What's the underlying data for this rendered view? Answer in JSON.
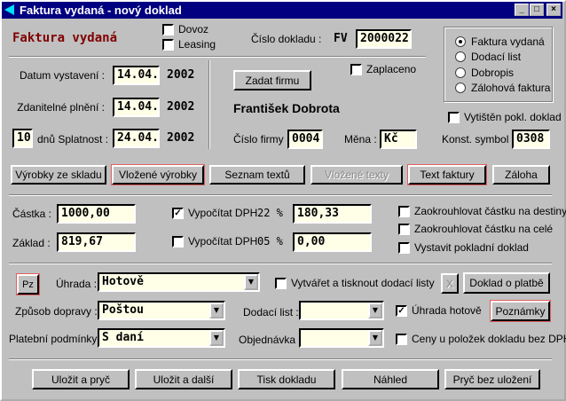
{
  "window": {
    "title": "Faktura vydaná - nový doklad",
    "minimize": "_",
    "maximize": "□",
    "close": "×"
  },
  "header": {
    "heading": "Faktura vydaná",
    "dovoz": "Dovoz",
    "leasing": "Leasing",
    "cislo_dokladu_label": "Číslo dokladu :",
    "prefix": "FV",
    "cislo_dokladu": "2000022"
  },
  "doc_type": {
    "options": [
      "Faktura vydaná",
      "Dodací list",
      "Dobropis",
      "Zálohová faktura"
    ],
    "selected": 0
  },
  "dates": {
    "vystaveni_label": "Datum vystavení :",
    "vystaveni": "14.04.",
    "vystaveni_year": "2002",
    "plneni_label": "Zdanitelné plnění :",
    "plneni": "14.04.",
    "plneni_year": "2002",
    "days": "10",
    "splatnost_label": "dnů  Splatnost :",
    "splatnost": "24.04.",
    "splatnost_year": "2002"
  },
  "firm": {
    "zadat_button": "Zadat firmu",
    "zaplaceno": "Zaplaceno",
    "name": "František Dobrota",
    "cislo_label": "Číslo firmy :",
    "cislo": "0004",
    "mena_label": "Měna :",
    "mena": "Kč",
    "vytisten": "Vytištěn pokl. doklad",
    "konst_label": "Konst. symbol :",
    "konst": "0308"
  },
  "tabs": [
    "Výrobky ze skladu",
    "Vložené výrobky",
    "Seznam textů",
    "Vložené texty",
    "Text faktury",
    "Záloha"
  ],
  "amounts": {
    "castka_label": "Částka :",
    "castka": "1000,00",
    "zaklad_label": "Základ :",
    "zaklad": "819,67",
    "dph1_label": "Vypočítat DPH",
    "dph1_rate": "22 %",
    "dph1": "180,33",
    "dph2_label": "Vypočítat DPH",
    "dph2_rate": "05 %",
    "dph2": "0,00",
    "round_dest": "Zaokrouhlovat částku na destiny",
    "round_whole": "Zaokrouhlovat částku na celé",
    "pokladni": "Vystavit pokladní doklad"
  },
  "payment": {
    "pz_button": "Pz",
    "uhrada_label": "Úhrada :",
    "uhrada": "Hotově",
    "vytvaret": "Vytvářet a tisknout dodací listy",
    "x_button": "X",
    "doklad_button": "Doklad o platbě",
    "doprava_label": "Způsob dopravy :",
    "doprava": "Poštou",
    "dodaci_label": "Dodací list :",
    "dodaci": "",
    "uhrada_hotove": "Úhrada hotově",
    "poznamky_button": "Poznámky",
    "podminky_label": "Platební podmínky :",
    "podminky": "S daní",
    "objednavka_label": "Objednávka :",
    "objednavka": "",
    "ceny": "Ceny u položek dokladu bez DPH"
  },
  "footer": [
    "Uložit a pryč",
    "Uložit a další",
    "Tisk dokladu",
    "Náhled",
    "Pryč bez uložení"
  ]
}
